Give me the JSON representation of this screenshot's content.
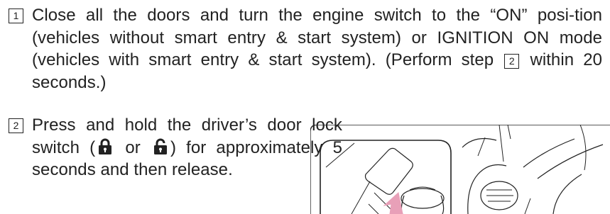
{
  "steps": [
    {
      "number": "1",
      "text_before_ref": "Close all the doors and turn the engine switch to the “ON” posi-tion (vehicles without smart entry & start system) or IGNITION ON mode (vehicles with smart entry & start system). (Perform step",
      "ref_number": "2",
      "text_after_ref": "within 20 seconds.)"
    },
    {
      "number": "2",
      "text_part1": "Press and hold the driver’s door lock switch (",
      "text_or": "or",
      "text_part2": ") for approximately 5 seconds and then release."
    }
  ],
  "icons": {
    "lock": "padlock-locked-icon",
    "unlock": "padlock-unlocked-icon"
  },
  "colors": {
    "text": "#222222",
    "arrow": "#e8a0b8"
  }
}
